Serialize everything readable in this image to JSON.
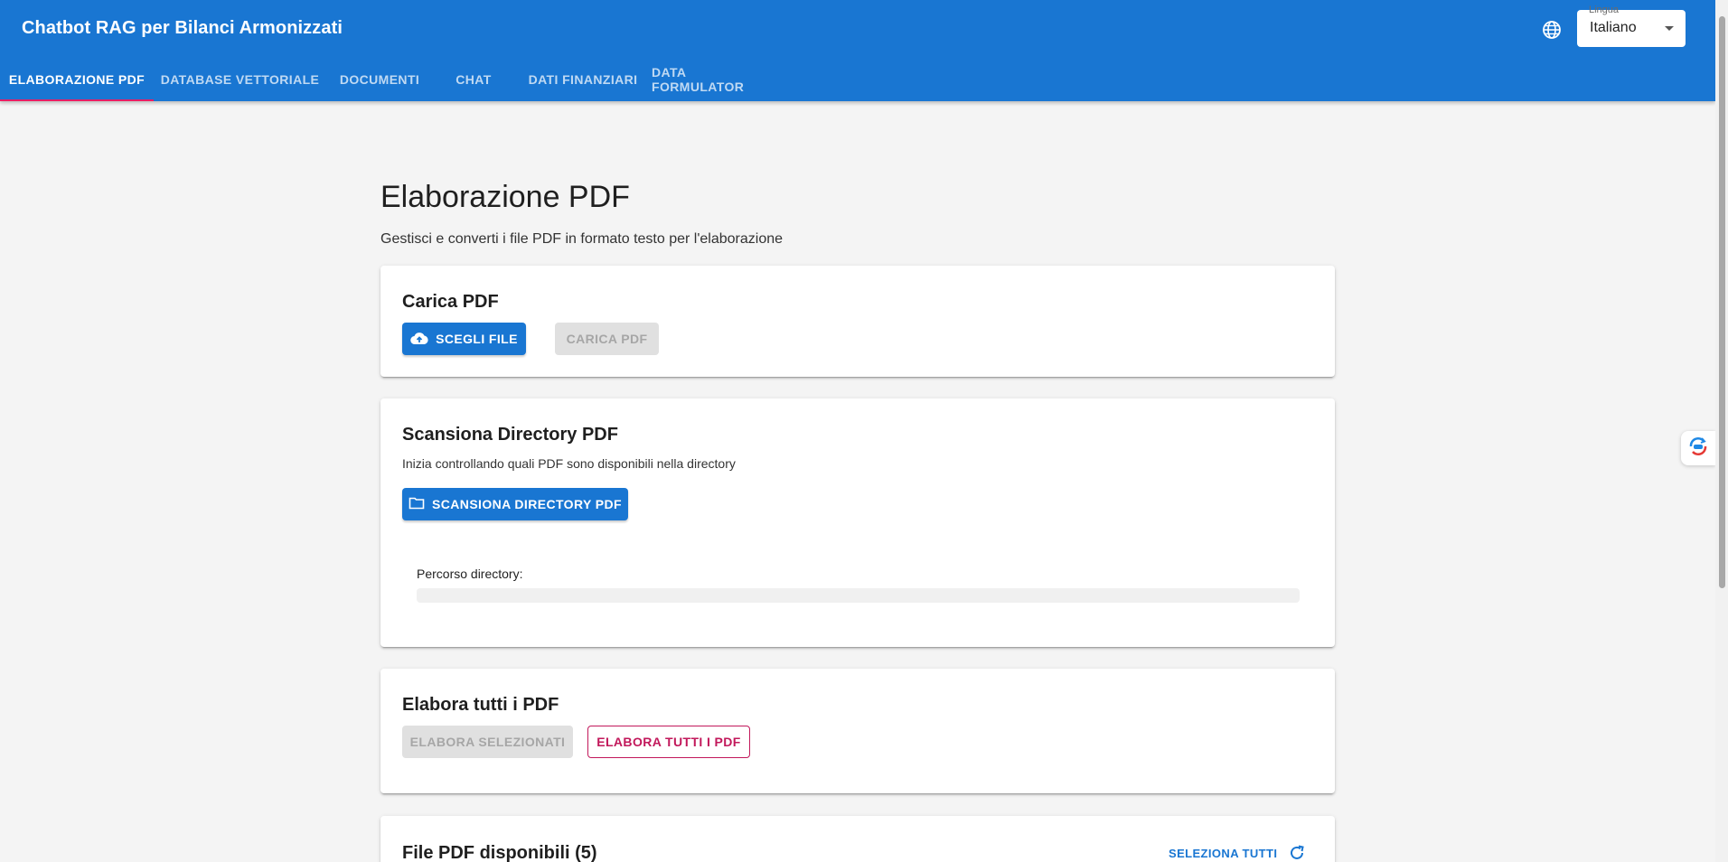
{
  "app": {
    "title": "Chatbot RAG per Bilanci Armonizzati",
    "language_label": "Lingua",
    "language_value": "Italiano"
  },
  "tabs": [
    {
      "label": "ELABORAZIONE PDF",
      "active": true
    },
    {
      "label": "DATABASE VETTORIALE",
      "active": false
    },
    {
      "label": "DOCUMENTI",
      "active": false
    },
    {
      "label": "CHAT",
      "active": false
    },
    {
      "label": "DATI FINANZIARI",
      "active": false
    },
    {
      "label": "DATA FORMULATOR",
      "active": false
    }
  ],
  "page": {
    "title": "Elaborazione PDF",
    "subtitle": "Gestisci e converti i file PDF in formato testo per l'elaborazione"
  },
  "upload": {
    "title": "Carica PDF",
    "choose_label": "SCEGLI FILE",
    "upload_label": "CARICA PDF"
  },
  "scan": {
    "title": "Scansiona Directory PDF",
    "description": "Inizia controllando quali PDF sono disponibili nella directory",
    "button_label": "SCANSIONA DIRECTORY PDF",
    "path_label": "Percorso directory:",
    "path_value": ""
  },
  "process": {
    "title": "Elabora tutti i PDF",
    "selected_label": "ELABORA SELEZIONATI",
    "all_label": "ELABORA TUTTI I PDF"
  },
  "files": {
    "title": "File PDF disponibili (5)",
    "select_all_label": "SELEZIONA TUTTI"
  },
  "colors": {
    "primary": "#1976d2",
    "accent": "#e91e63",
    "secondary": "#c2185b",
    "background": "#f4f4f4"
  },
  "icons": [
    "globe-icon",
    "caret-down-icon",
    "cloud-upload-icon",
    "folder-icon",
    "refresh-icon",
    "translate-widget-icon"
  ]
}
